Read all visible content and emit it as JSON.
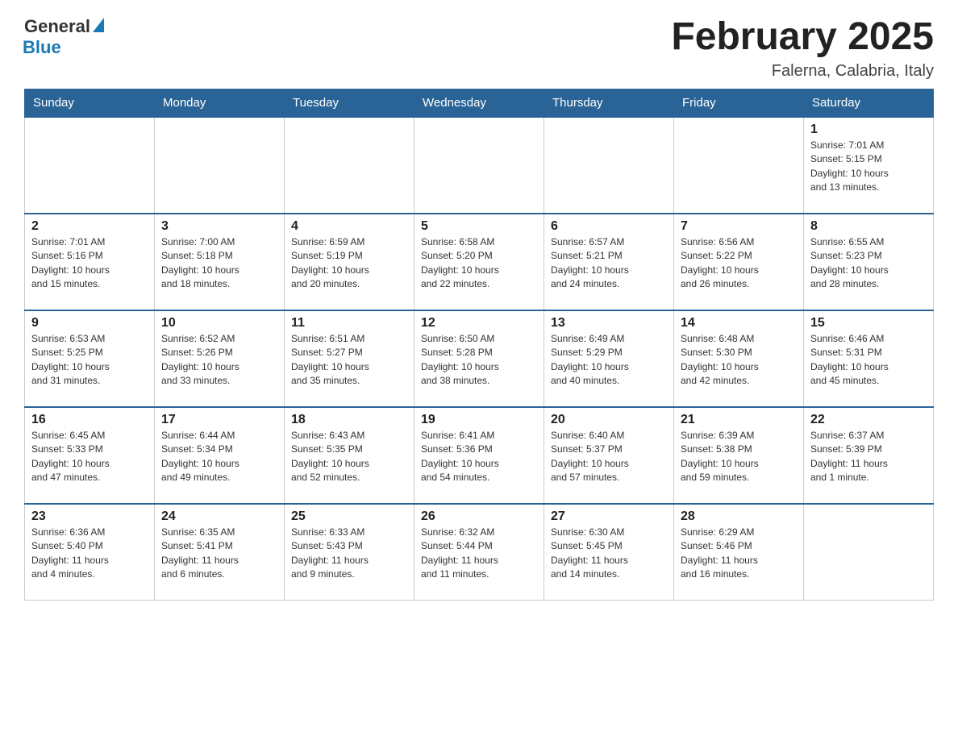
{
  "logo": {
    "general": "General",
    "blue": "Blue"
  },
  "title": "February 2025",
  "subtitle": "Falerna, Calabria, Italy",
  "days_of_week": [
    "Sunday",
    "Monday",
    "Tuesday",
    "Wednesday",
    "Thursday",
    "Friday",
    "Saturday"
  ],
  "weeks": [
    [
      {
        "day": "",
        "info": ""
      },
      {
        "day": "",
        "info": ""
      },
      {
        "day": "",
        "info": ""
      },
      {
        "day": "",
        "info": ""
      },
      {
        "day": "",
        "info": ""
      },
      {
        "day": "",
        "info": ""
      },
      {
        "day": "1",
        "info": "Sunrise: 7:01 AM\nSunset: 5:15 PM\nDaylight: 10 hours\nand 13 minutes."
      }
    ],
    [
      {
        "day": "2",
        "info": "Sunrise: 7:01 AM\nSunset: 5:16 PM\nDaylight: 10 hours\nand 15 minutes."
      },
      {
        "day": "3",
        "info": "Sunrise: 7:00 AM\nSunset: 5:18 PM\nDaylight: 10 hours\nand 18 minutes."
      },
      {
        "day": "4",
        "info": "Sunrise: 6:59 AM\nSunset: 5:19 PM\nDaylight: 10 hours\nand 20 minutes."
      },
      {
        "day": "5",
        "info": "Sunrise: 6:58 AM\nSunset: 5:20 PM\nDaylight: 10 hours\nand 22 minutes."
      },
      {
        "day": "6",
        "info": "Sunrise: 6:57 AM\nSunset: 5:21 PM\nDaylight: 10 hours\nand 24 minutes."
      },
      {
        "day": "7",
        "info": "Sunrise: 6:56 AM\nSunset: 5:22 PM\nDaylight: 10 hours\nand 26 minutes."
      },
      {
        "day": "8",
        "info": "Sunrise: 6:55 AM\nSunset: 5:23 PM\nDaylight: 10 hours\nand 28 minutes."
      }
    ],
    [
      {
        "day": "9",
        "info": "Sunrise: 6:53 AM\nSunset: 5:25 PM\nDaylight: 10 hours\nand 31 minutes."
      },
      {
        "day": "10",
        "info": "Sunrise: 6:52 AM\nSunset: 5:26 PM\nDaylight: 10 hours\nand 33 minutes."
      },
      {
        "day": "11",
        "info": "Sunrise: 6:51 AM\nSunset: 5:27 PM\nDaylight: 10 hours\nand 35 minutes."
      },
      {
        "day": "12",
        "info": "Sunrise: 6:50 AM\nSunset: 5:28 PM\nDaylight: 10 hours\nand 38 minutes."
      },
      {
        "day": "13",
        "info": "Sunrise: 6:49 AM\nSunset: 5:29 PM\nDaylight: 10 hours\nand 40 minutes."
      },
      {
        "day": "14",
        "info": "Sunrise: 6:48 AM\nSunset: 5:30 PM\nDaylight: 10 hours\nand 42 minutes."
      },
      {
        "day": "15",
        "info": "Sunrise: 6:46 AM\nSunset: 5:31 PM\nDaylight: 10 hours\nand 45 minutes."
      }
    ],
    [
      {
        "day": "16",
        "info": "Sunrise: 6:45 AM\nSunset: 5:33 PM\nDaylight: 10 hours\nand 47 minutes."
      },
      {
        "day": "17",
        "info": "Sunrise: 6:44 AM\nSunset: 5:34 PM\nDaylight: 10 hours\nand 49 minutes."
      },
      {
        "day": "18",
        "info": "Sunrise: 6:43 AM\nSunset: 5:35 PM\nDaylight: 10 hours\nand 52 minutes."
      },
      {
        "day": "19",
        "info": "Sunrise: 6:41 AM\nSunset: 5:36 PM\nDaylight: 10 hours\nand 54 minutes."
      },
      {
        "day": "20",
        "info": "Sunrise: 6:40 AM\nSunset: 5:37 PM\nDaylight: 10 hours\nand 57 minutes."
      },
      {
        "day": "21",
        "info": "Sunrise: 6:39 AM\nSunset: 5:38 PM\nDaylight: 10 hours\nand 59 minutes."
      },
      {
        "day": "22",
        "info": "Sunrise: 6:37 AM\nSunset: 5:39 PM\nDaylight: 11 hours\nand 1 minute."
      }
    ],
    [
      {
        "day": "23",
        "info": "Sunrise: 6:36 AM\nSunset: 5:40 PM\nDaylight: 11 hours\nand 4 minutes."
      },
      {
        "day": "24",
        "info": "Sunrise: 6:35 AM\nSunset: 5:41 PM\nDaylight: 11 hours\nand 6 minutes."
      },
      {
        "day": "25",
        "info": "Sunrise: 6:33 AM\nSunset: 5:43 PM\nDaylight: 11 hours\nand 9 minutes."
      },
      {
        "day": "26",
        "info": "Sunrise: 6:32 AM\nSunset: 5:44 PM\nDaylight: 11 hours\nand 11 minutes."
      },
      {
        "day": "27",
        "info": "Sunrise: 6:30 AM\nSunset: 5:45 PM\nDaylight: 11 hours\nand 14 minutes."
      },
      {
        "day": "28",
        "info": "Sunrise: 6:29 AM\nSunset: 5:46 PM\nDaylight: 11 hours\nand 16 minutes."
      },
      {
        "day": "",
        "info": ""
      }
    ]
  ]
}
